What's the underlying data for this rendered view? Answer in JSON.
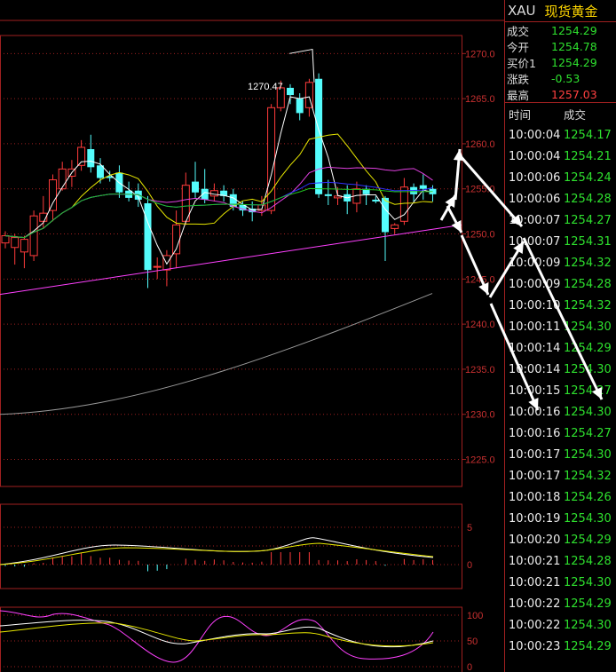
{
  "quote": {
    "symbol": "XAU",
    "name": "现货黄金",
    "rows": [
      {
        "label": "成交",
        "value": "1254.29",
        "color": "green"
      },
      {
        "label": "今开",
        "value": "1254.78",
        "color": "green"
      },
      {
        "label": "买价1",
        "value": "1254.29",
        "color": "green"
      },
      {
        "label": "涨跌",
        "value": "-0.53",
        "color": "green"
      },
      {
        "label": "最高",
        "value": "1257.03",
        "color": "red"
      }
    ]
  },
  "trades_header": {
    "time": "时间",
    "price": "成交"
  },
  "trades": [
    {
      "time": "10:00:04",
      "price": "1254.17"
    },
    {
      "time": "10:00:04",
      "price": "1254.21"
    },
    {
      "time": "10:00:06",
      "price": "1254.24"
    },
    {
      "time": "10:00:06",
      "price": "1254.28"
    },
    {
      "time": "10:00:07",
      "price": "1254.27"
    },
    {
      "time": "10:00:07",
      "price": "1254.31"
    },
    {
      "time": "10:00:09",
      "price": "1254.32"
    },
    {
      "time": "10:00:09",
      "price": "1254.28"
    },
    {
      "time": "10:00:10",
      "price": "1254.32"
    },
    {
      "time": "10:00:11",
      "price": "1254.30"
    },
    {
      "time": "10:00:14",
      "price": "1254.29"
    },
    {
      "time": "10:00:14",
      "price": "1254.30"
    },
    {
      "time": "10:00:15",
      "price": "1254.27"
    },
    {
      "time": "10:00:16",
      "price": "1254.30"
    },
    {
      "time": "10:00:16",
      "price": "1254.27"
    },
    {
      "time": "10:00:17",
      "price": "1254.30"
    },
    {
      "time": "10:00:17",
      "price": "1254.32"
    },
    {
      "time": "10:00:18",
      "price": "1254.26"
    },
    {
      "time": "10:00:19",
      "price": "1254.30"
    },
    {
      "time": "10:00:20",
      "price": "1254.29"
    },
    {
      "time": "10:00:21",
      "price": "1254.28"
    },
    {
      "time": "10:00:21",
      "price": "1254.30"
    },
    {
      "time": "10:00:22",
      "price": "1254.29"
    },
    {
      "time": "10:00:22",
      "price": "1254.30"
    },
    {
      "time": "10:00:23",
      "price": "1254.29"
    }
  ],
  "chart_data": {
    "type": "candlestick",
    "price_axis": {
      "min": 1222,
      "max": 1272,
      "ticks": [
        "1270.0",
        "1265.0",
        "1260.0",
        "1255.0",
        "1250.0",
        "1245.0",
        "1240.0",
        "1235.0",
        "1230.0",
        "1225.0"
      ]
    },
    "peak_annotation": "1270.47",
    "candles": [
      [
        1249.0,
        1249.8,
        1248.4,
        1250.3
      ],
      [
        1248.5,
        1249.6,
        1246.6,
        1250.0
      ],
      [
        1248.0,
        1249.4,
        1246.2,
        1249.8
      ],
      [
        1247.6,
        1252.0,
        1247.0,
        1252.6
      ],
      [
        1251.4,
        1252.3,
        1250.6,
        1254.2
      ],
      [
        1252.6,
        1256.0,
        1251.4,
        1256.6
      ],
      [
        1255.0,
        1257.2,
        1254.8,
        1258.0
      ],
      [
        1256.4,
        1257.2,
        1255.2,
        1258.2
      ],
      [
        1257.6,
        1259.6,
        1257.0,
        1260.4
      ],
      [
        1259.4,
        1257.4,
        1256.8,
        1261.0
      ],
      [
        1257.6,
        1256.2,
        1255.6,
        1258.4
      ],
      [
        1256.4,
        1256.2,
        1255.8,
        1257.0
      ],
      [
        1256.8,
        1254.6,
        1254.0,
        1257.6
      ],
      [
        1254.8,
        1254.0,
        1253.6,
        1255.8
      ],
      [
        1254.8,
        1253.8,
        1253.0,
        1255.6
      ],
      [
        1253.4,
        1246.0,
        1244.0,
        1254.2
      ],
      [
        1246.4,
        1246.4,
        1245.0,
        1247.4
      ],
      [
        1246.0,
        1247.6,
        1244.2,
        1248.2
      ],
      [
        1247.8,
        1251.0,
        1246.2,
        1252.6
      ],
      [
        1251.4,
        1255.4,
        1251.0,
        1256.8
      ],
      [
        1255.8,
        1254.6,
        1254.0,
        1258.0
      ],
      [
        1255.0,
        1253.8,
        1253.4,
        1257.2
      ],
      [
        1254.2,
        1254.8,
        1253.6,
        1255.6
      ],
      [
        1254.8,
        1254.2,
        1253.6,
        1255.4
      ],
      [
        1254.4,
        1253.0,
        1252.6,
        1255.0
      ],
      [
        1253.2,
        1252.6,
        1252.0,
        1253.6
      ],
      [
        1252.8,
        1252.4,
        1251.4,
        1253.6
      ],
      [
        1252.6,
        1253.2,
        1252.0,
        1254.2
      ],
      [
        1252.6,
        1264.0,
        1252.2,
        1264.4
      ],
      [
        1264.0,
        1266.2,
        1263.6,
        1267.0
      ],
      [
        1266.2,
        1265.4,
        1264.4,
        1266.6
      ],
      [
        1265.0,
        1263.4,
        1262.6,
        1265.6
      ],
      [
        1264.0,
        1266.8,
        1263.0,
        1267.2
      ],
      [
        1267.2,
        1254.4,
        1254.0,
        1267.8
      ],
      [
        1254.4,
        1254.2,
        1253.2,
        1256.0
      ],
      [
        1254.0,
        1254.2,
        1253.2,
        1255.2
      ],
      [
        1254.4,
        1253.6,
        1252.2,
        1255.4
      ],
      [
        1253.4,
        1255.0,
        1252.4,
        1255.8
      ],
      [
        1255.0,
        1254.4,
        1253.2,
        1255.4
      ],
      [
        1253.8,
        1253.6,
        1253.4,
        1254.2
      ],
      [
        1254.0,
        1250.2,
        1247.0,
        1254.2
      ],
      [
        1250.6,
        1251.0,
        1250.0,
        1251.2
      ],
      [
        1251.4,
        1255.2,
        1251.0,
        1256.2
      ],
      [
        1255.2,
        1254.4,
        1253.6,
        1255.6
      ],
      [
        1255.4,
        1255.0,
        1253.8,
        1256.6
      ],
      [
        1255.0,
        1254.4,
        1253.6,
        1255.4
      ]
    ],
    "macd_ticks": [
      "5",
      "0"
    ],
    "kdj_ticks": [
      "100",
      "50",
      "0"
    ]
  }
}
